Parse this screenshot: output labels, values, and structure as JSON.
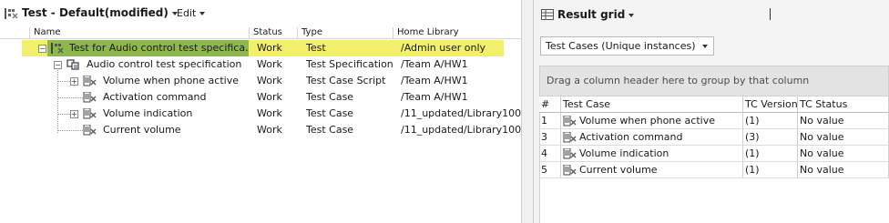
{
  "left": {
    "title": "Test - Default(modified)",
    "edit_menu": "Edit",
    "columns": [
      "Name",
      "Status",
      "Type",
      "Home Library"
    ],
    "rows": [
      {
        "name": "Test for Audio control test specifica...",
        "status": "Work",
        "type": "Test",
        "library": "/Admin user only",
        "expander": "−",
        "icon": "test-icon"
      },
      {
        "name": "Audio control test specification",
        "status": "Work",
        "type": "Test Specification",
        "library": "/Team A/HW1",
        "expander": "−",
        "icon": "test-specification-icon"
      },
      {
        "name": "Volume when phone active",
        "status": "Work",
        "type": "Test Case Script",
        "library": "/Team A/HW1",
        "expander": "+",
        "icon": "test-case-script-icon"
      },
      {
        "name": "Activation command",
        "status": "Work",
        "type": "Test Case",
        "library": "/Team A/HW1",
        "expander": "",
        "icon": "test-case-icon"
      },
      {
        "name": "Volume indication",
        "status": "Work",
        "type": "Test Case",
        "library": "/11_updated/Library100",
        "expander": "+",
        "icon": "test-case-icon"
      },
      {
        "name": "Current volume",
        "status": "Work",
        "type": "Test Case",
        "library": "/11_updated/Library100",
        "expander": "",
        "icon": "test-case-icon"
      }
    ]
  },
  "right": {
    "title": "Result grid",
    "view_selector": "Test Cases (Unique instances)",
    "group_hint": "Drag a column header here to group by that column",
    "columns": [
      "#",
      "Test Case",
      "TC Version",
      "TC Status"
    ],
    "rows": [
      {
        "num": "1",
        "test_case": "Volume when phone active",
        "version": "(1)",
        "status": "No value"
      },
      {
        "num": "3",
        "test_case": "Activation command",
        "version": "(3)",
        "status": "No value"
      },
      {
        "num": "4",
        "test_case": "Volume indication",
        "version": "(1)",
        "status": "No value"
      },
      {
        "num": "5",
        "test_case": "Current volume",
        "version": "(1)",
        "status": "No value"
      }
    ]
  },
  "colors": {
    "selection_row": "#f2ef6a",
    "selection_name": "#8fb84c",
    "group_panel": "#e3e3e3"
  }
}
